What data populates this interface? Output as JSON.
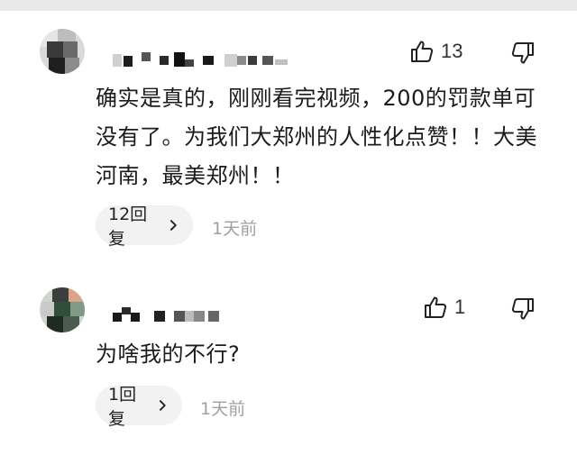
{
  "comments": [
    {
      "likes": "13",
      "text": "确实是真的，刚刚看完视频，200的罚款单可没有了。为我们大郑州的人性化点赞！！大美河南，最美郑州！！",
      "reply_label": "12回复",
      "time": "1天前"
    },
    {
      "likes": "1",
      "text": "为啥我的不行?",
      "reply_label": "1回复",
      "time": "1天前"
    }
  ],
  "icons": {
    "like": "thumbs-up-icon",
    "dislike": "thumbs-down-icon",
    "chevron": "chevron-right-icon"
  },
  "colors": {
    "text": "#1b1b1b",
    "muted": "#a0a0a0",
    "pill_bg": "#f2f2f2"
  }
}
